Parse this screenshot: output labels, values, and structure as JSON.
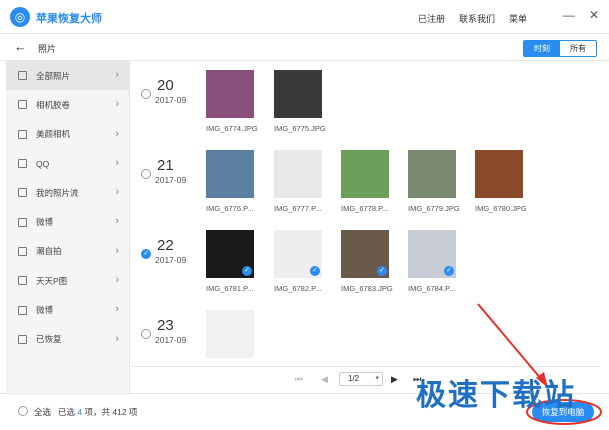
{
  "app": {
    "title": "苹果恢复大师",
    "links": [
      "已注册",
      "联系我们",
      "菜单"
    ]
  },
  "window": {
    "minimize": "—",
    "close": "✕"
  },
  "subbar": {
    "back": "←",
    "title": "照片",
    "tabs": [
      "时刻",
      "所有"
    ]
  },
  "sidebar": {
    "items": [
      {
        "label": "全部照片",
        "icon": "document-icon",
        "active": true
      },
      {
        "label": "相机胶卷",
        "icon": "image-icon"
      },
      {
        "label": "美颜相机",
        "icon": "image-icon"
      },
      {
        "label": "QQ",
        "icon": "image-icon"
      },
      {
        "label": "我的照片流",
        "icon": "image-icon"
      },
      {
        "label": "微博",
        "icon": "image-icon"
      },
      {
        "label": "潮自拍",
        "icon": "image-icon"
      },
      {
        "label": "天天P图",
        "icon": "image-icon"
      },
      {
        "label": "微博",
        "icon": "image-icon"
      },
      {
        "label": "已恢复",
        "icon": "image-icon"
      }
    ]
  },
  "groups": [
    {
      "day": "20",
      "ym": "2017-09",
      "checked": false,
      "photos": [
        {
          "name": "IMG_6774.JPG",
          "color": "#8a4f7a",
          "checked": false
        },
        {
          "name": "IMG_6775.JPG",
          "color": "#3a3a3a",
          "checked": false
        }
      ]
    },
    {
      "day": "21",
      "ym": "2017-09",
      "checked": false,
      "photos": [
        {
          "name": "IMG_6776.P...",
          "color": "#5b7fa0",
          "checked": false
        },
        {
          "name": "IMG_6777.P...",
          "color": "#e8e8e8",
          "checked": false
        },
        {
          "name": "IMG_6778.P...",
          "color": "#6aa05a",
          "checked": false
        },
        {
          "name": "IMG_6779.JPG",
          "color": "#7a8a70",
          "checked": false
        },
        {
          "name": "IMG_6780.JPG",
          "color": "#8a4a2a",
          "checked": false
        }
      ]
    },
    {
      "day": "22",
      "ym": "2017-09",
      "checked": true,
      "photos": [
        {
          "name": "IMG_6781.P...",
          "color": "#1a1a1a",
          "checked": true
        },
        {
          "name": "IMG_6782.P...",
          "color": "#eeeeee",
          "checked": true
        },
        {
          "name": "IMG_6783.JPG",
          "color": "#6a5a4a",
          "checked": true
        },
        {
          "name": "IMG_6784.P...",
          "color": "#c8ccd4",
          "checked": true
        }
      ]
    },
    {
      "day": "23",
      "ym": "2017-09",
      "checked": false,
      "photos": [
        {
          "name": "",
          "color": "#f2f2f2",
          "checked": false
        }
      ]
    }
  ],
  "pager": {
    "page": "1/2",
    "first": "⏮",
    "prev": "◀",
    "next": "▶",
    "last": "⏭",
    "dropdown": "▾"
  },
  "footer": {
    "select_all": "全选",
    "prefix": "已选",
    "count": "4",
    "suffix": "项，共 412 项",
    "recover": "恢复到电脑"
  },
  "watermark": "极速下载站",
  "accent": "#2a8cf0"
}
